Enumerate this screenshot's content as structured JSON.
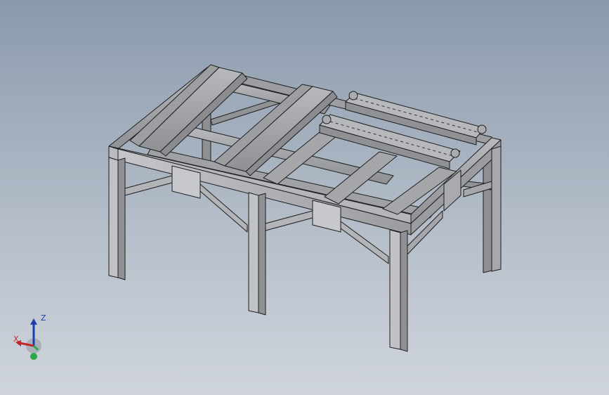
{
  "viewport": {
    "background_top": "#8a9aad",
    "background_bottom": "#d0d5dc",
    "model_color": "#a9abaf",
    "edge_color": "#1e1e1e"
  },
  "triad": {
    "x_label": "X",
    "z_label": "Z",
    "x_color": "#c0262c",
    "y_color": "#2ea84a",
    "z_color": "#1c3fb0"
  }
}
